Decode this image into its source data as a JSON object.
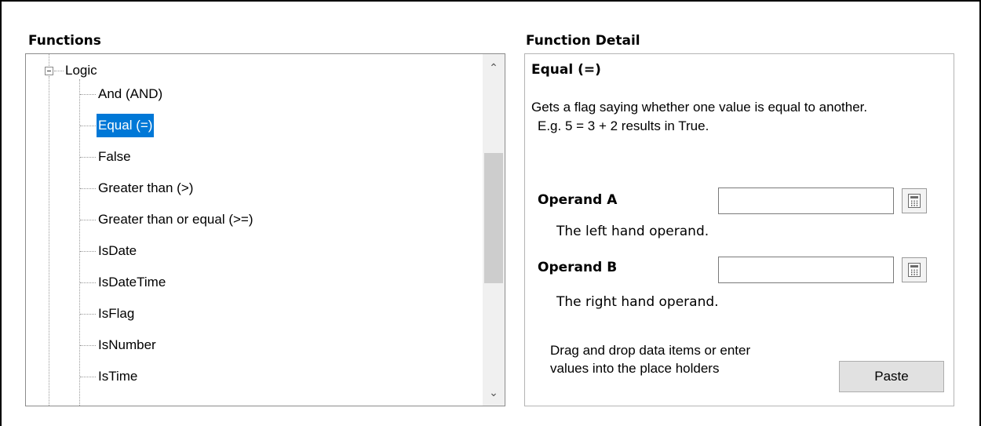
{
  "functions_panel": {
    "title": "Functions",
    "tree": {
      "root_label": "Logic",
      "items": [
        {
          "label": "And (AND)"
        },
        {
          "label": "Equal (=)",
          "selected": true
        },
        {
          "label": "False"
        },
        {
          "label": "Greater than (>)"
        },
        {
          "label": "Greater than or equal (>=)"
        },
        {
          "label": "IsDate"
        },
        {
          "label": "IsDateTime"
        },
        {
          "label": "IsFlag"
        },
        {
          "label": "IsNumber"
        },
        {
          "label": "IsTime"
        }
      ]
    },
    "scrollbar": {
      "up_icon": "chevron-up-icon",
      "down_icon": "chevron-down-icon"
    }
  },
  "detail_panel": {
    "title": "Function Detail",
    "function_name": "Equal (=)",
    "description": "Gets a flag saying whether one value is equal to another.",
    "example": "E.g. 5 = 3 + 2 results in True.",
    "operand_a": {
      "label": "Operand A",
      "help": "The left hand operand.",
      "value": ""
    },
    "operand_b": {
      "label": "Operand B",
      "help": "The right hand operand.",
      "value": ""
    },
    "drag_hint_line1": "Drag and drop data items or enter",
    "drag_hint_line2": "values into the place holders",
    "paste_label": "Paste"
  },
  "colors": {
    "selection": "#0078d7",
    "border": "#8c8c8c"
  }
}
